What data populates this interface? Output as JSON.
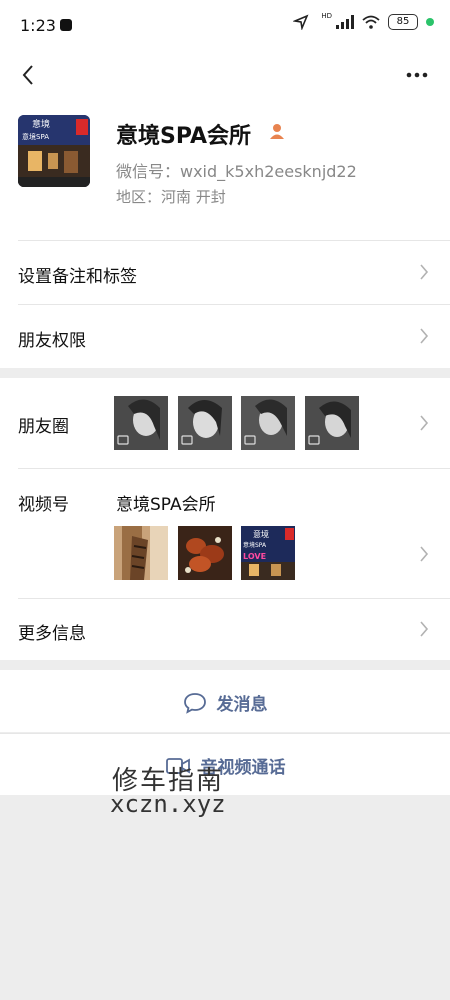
{
  "status_bar": {
    "time": "1:23",
    "battery": "85",
    "signal_label": "HD"
  },
  "nav": {
    "back_icon": "chevron-left-icon",
    "more_icon": "more-dots-icon"
  },
  "profile": {
    "avatar_sign_line1": "意境",
    "avatar_sign_line2": "意境SPA",
    "name": "意境SPA会所",
    "gender_icon": "female-person-icon",
    "wechat_id": "微信号：wxid_k5xh2eesknjd22",
    "region": "地区：河南  开封"
  },
  "rows": {
    "remark_label": "设置备注和标签",
    "permission_label": "朋友权限",
    "moments_label": "朋友圈",
    "channels_label": "视频号",
    "channels_name": "意境SPA会所",
    "more_info_label": "更多信息"
  },
  "thumb_sign": {
    "line1": "意境",
    "line2": "意境SPA",
    "love": "LOVE"
  },
  "actions": {
    "message_label": "发消息",
    "call_label": "音视频通话"
  },
  "watermark": {
    "cn": "修车指南",
    "en": "xczn.xyz"
  },
  "colors": {
    "link": "#576b95",
    "background": "#ededed",
    "muted_text": "#888888"
  }
}
